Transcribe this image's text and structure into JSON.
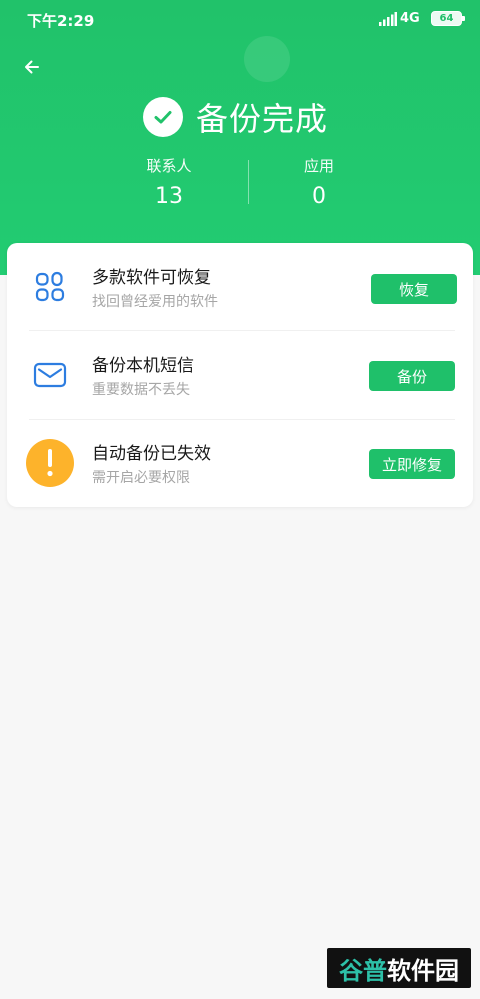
{
  "status_bar": {
    "time": "下午2:29",
    "network": "4G",
    "battery": "64",
    "signal_icon": "signal-icon"
  },
  "header": {
    "back_icon": "arrow-left-icon",
    "title": "备份完成",
    "check_icon": "check-icon",
    "stats": [
      {
        "label": "联系人",
        "value": "13"
      },
      {
        "label": "应用",
        "value": "0"
      }
    ]
  },
  "list": [
    {
      "icon": "apps-grid-icon",
      "title": "多款软件可恢复",
      "subtitle": "找回曾经爱用的软件",
      "button": "恢复"
    },
    {
      "icon": "mail-icon",
      "title": "备份本机短信",
      "subtitle": "重要数据不丢失",
      "button": "备份"
    },
    {
      "icon": "warning-icon",
      "title": "自动备份已失效",
      "subtitle": "需开启必要权限",
      "button": "立即修复"
    }
  ],
  "watermark": {
    "part_a": "谷普",
    "part_b": "软件园"
  },
  "colors": {
    "accent": "#1fc06a",
    "header": "#22c56d",
    "icon_blue": "#2d7de0",
    "warning": "#fdb32b",
    "subtitle": "#a6a6a6"
  }
}
